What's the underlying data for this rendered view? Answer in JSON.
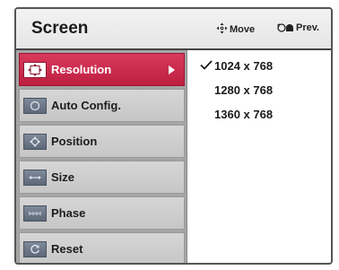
{
  "screen": {
    "title": "Screen",
    "hints": {
      "move_label": "Move",
      "prev_label": "Prev."
    }
  },
  "menu": {
    "items": [
      {
        "label": "Resolution",
        "icon": "resolution-icon",
        "selected": true
      },
      {
        "label": "Auto Config.",
        "icon": "auto-config-icon",
        "selected": false
      },
      {
        "label": "Position",
        "icon": "position-icon",
        "selected": false
      },
      {
        "label": "Size",
        "icon": "size-icon",
        "selected": false
      },
      {
        "label": "Phase",
        "icon": "phase-icon",
        "selected": false
      },
      {
        "label": "Reset",
        "icon": "reset-icon",
        "selected": false
      }
    ]
  },
  "options": {
    "items": [
      {
        "label": "1024 x 768",
        "checked": true
      },
      {
        "label": "1280 x 768",
        "checked": false
      },
      {
        "label": "1360 x 768",
        "checked": false
      }
    ]
  },
  "colors": {
    "selected_accent": "#c8244a",
    "menu_panel": "#a5a5a5",
    "menu_item": "#cfcfcf"
  }
}
